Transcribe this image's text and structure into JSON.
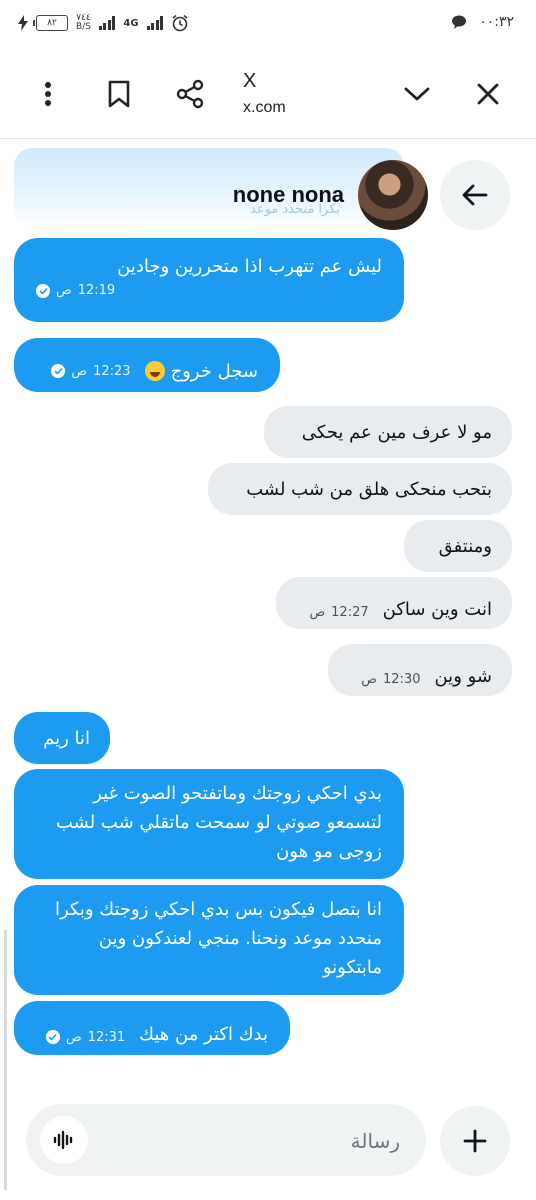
{
  "status_bar": {
    "battery": "٨٢",
    "net_speed_value": "٧٤٤",
    "net_speed_unit": "B/S",
    "network_type": "4G",
    "time": "٠٠:٣٢",
    "icons": [
      "charging-icon",
      "signal-icon",
      "alarm-icon",
      "chat-notification-icon"
    ]
  },
  "browser": {
    "page_title": "X",
    "host": "x.com"
  },
  "header": {
    "peer_name": "none nona",
    "faded_text": "بكرا منحدد موعد"
  },
  "messages": [
    {
      "dir": "out",
      "text": "ليش عم تتهرب اذا متحررين وجادين",
      "time": "12:19",
      "ampm": "ص",
      "read": true
    },
    {
      "dir": "out",
      "text": "سجل خروج",
      "emoji": "rofl",
      "time": "12:23",
      "ampm": "ص",
      "read": true
    },
    {
      "dir": "in",
      "text": "مو لا عرف مين عم يحكى"
    },
    {
      "dir": "in",
      "text": "بتحب منحكى هلق من شب لشب"
    },
    {
      "dir": "in",
      "text": "ومنتفق"
    },
    {
      "dir": "in",
      "text": "انت وين ساكن",
      "time": "12:27",
      "ampm": "ص"
    },
    {
      "dir": "in",
      "text": "شو وين",
      "time": "12:30",
      "ampm": "ص"
    },
    {
      "dir": "out",
      "text": "انا ريم"
    },
    {
      "dir": "out",
      "text": "بدي احكي زوجتك وماتفتحو الصوت غير لتسمعو صوتي لو سمحت ماتقلي شب لشب زوجى مو هون"
    },
    {
      "dir": "out",
      "text": "انا بتصل فيكون بس بدي احكي زوجتك وبكرا منحدد موعد ونحنا. منجي لعندكون وين مابتكونو"
    },
    {
      "dir": "out",
      "text": "بدك اكتر من هيك",
      "time": "12:31",
      "ampm": "ص",
      "read": true
    }
  ],
  "composer": {
    "placeholder": "رسالة"
  },
  "colors": {
    "bubble_out": "#1d9bf0",
    "bubble_in": "#e9ecee",
    "icon_button_bg": "#eff3f4"
  }
}
